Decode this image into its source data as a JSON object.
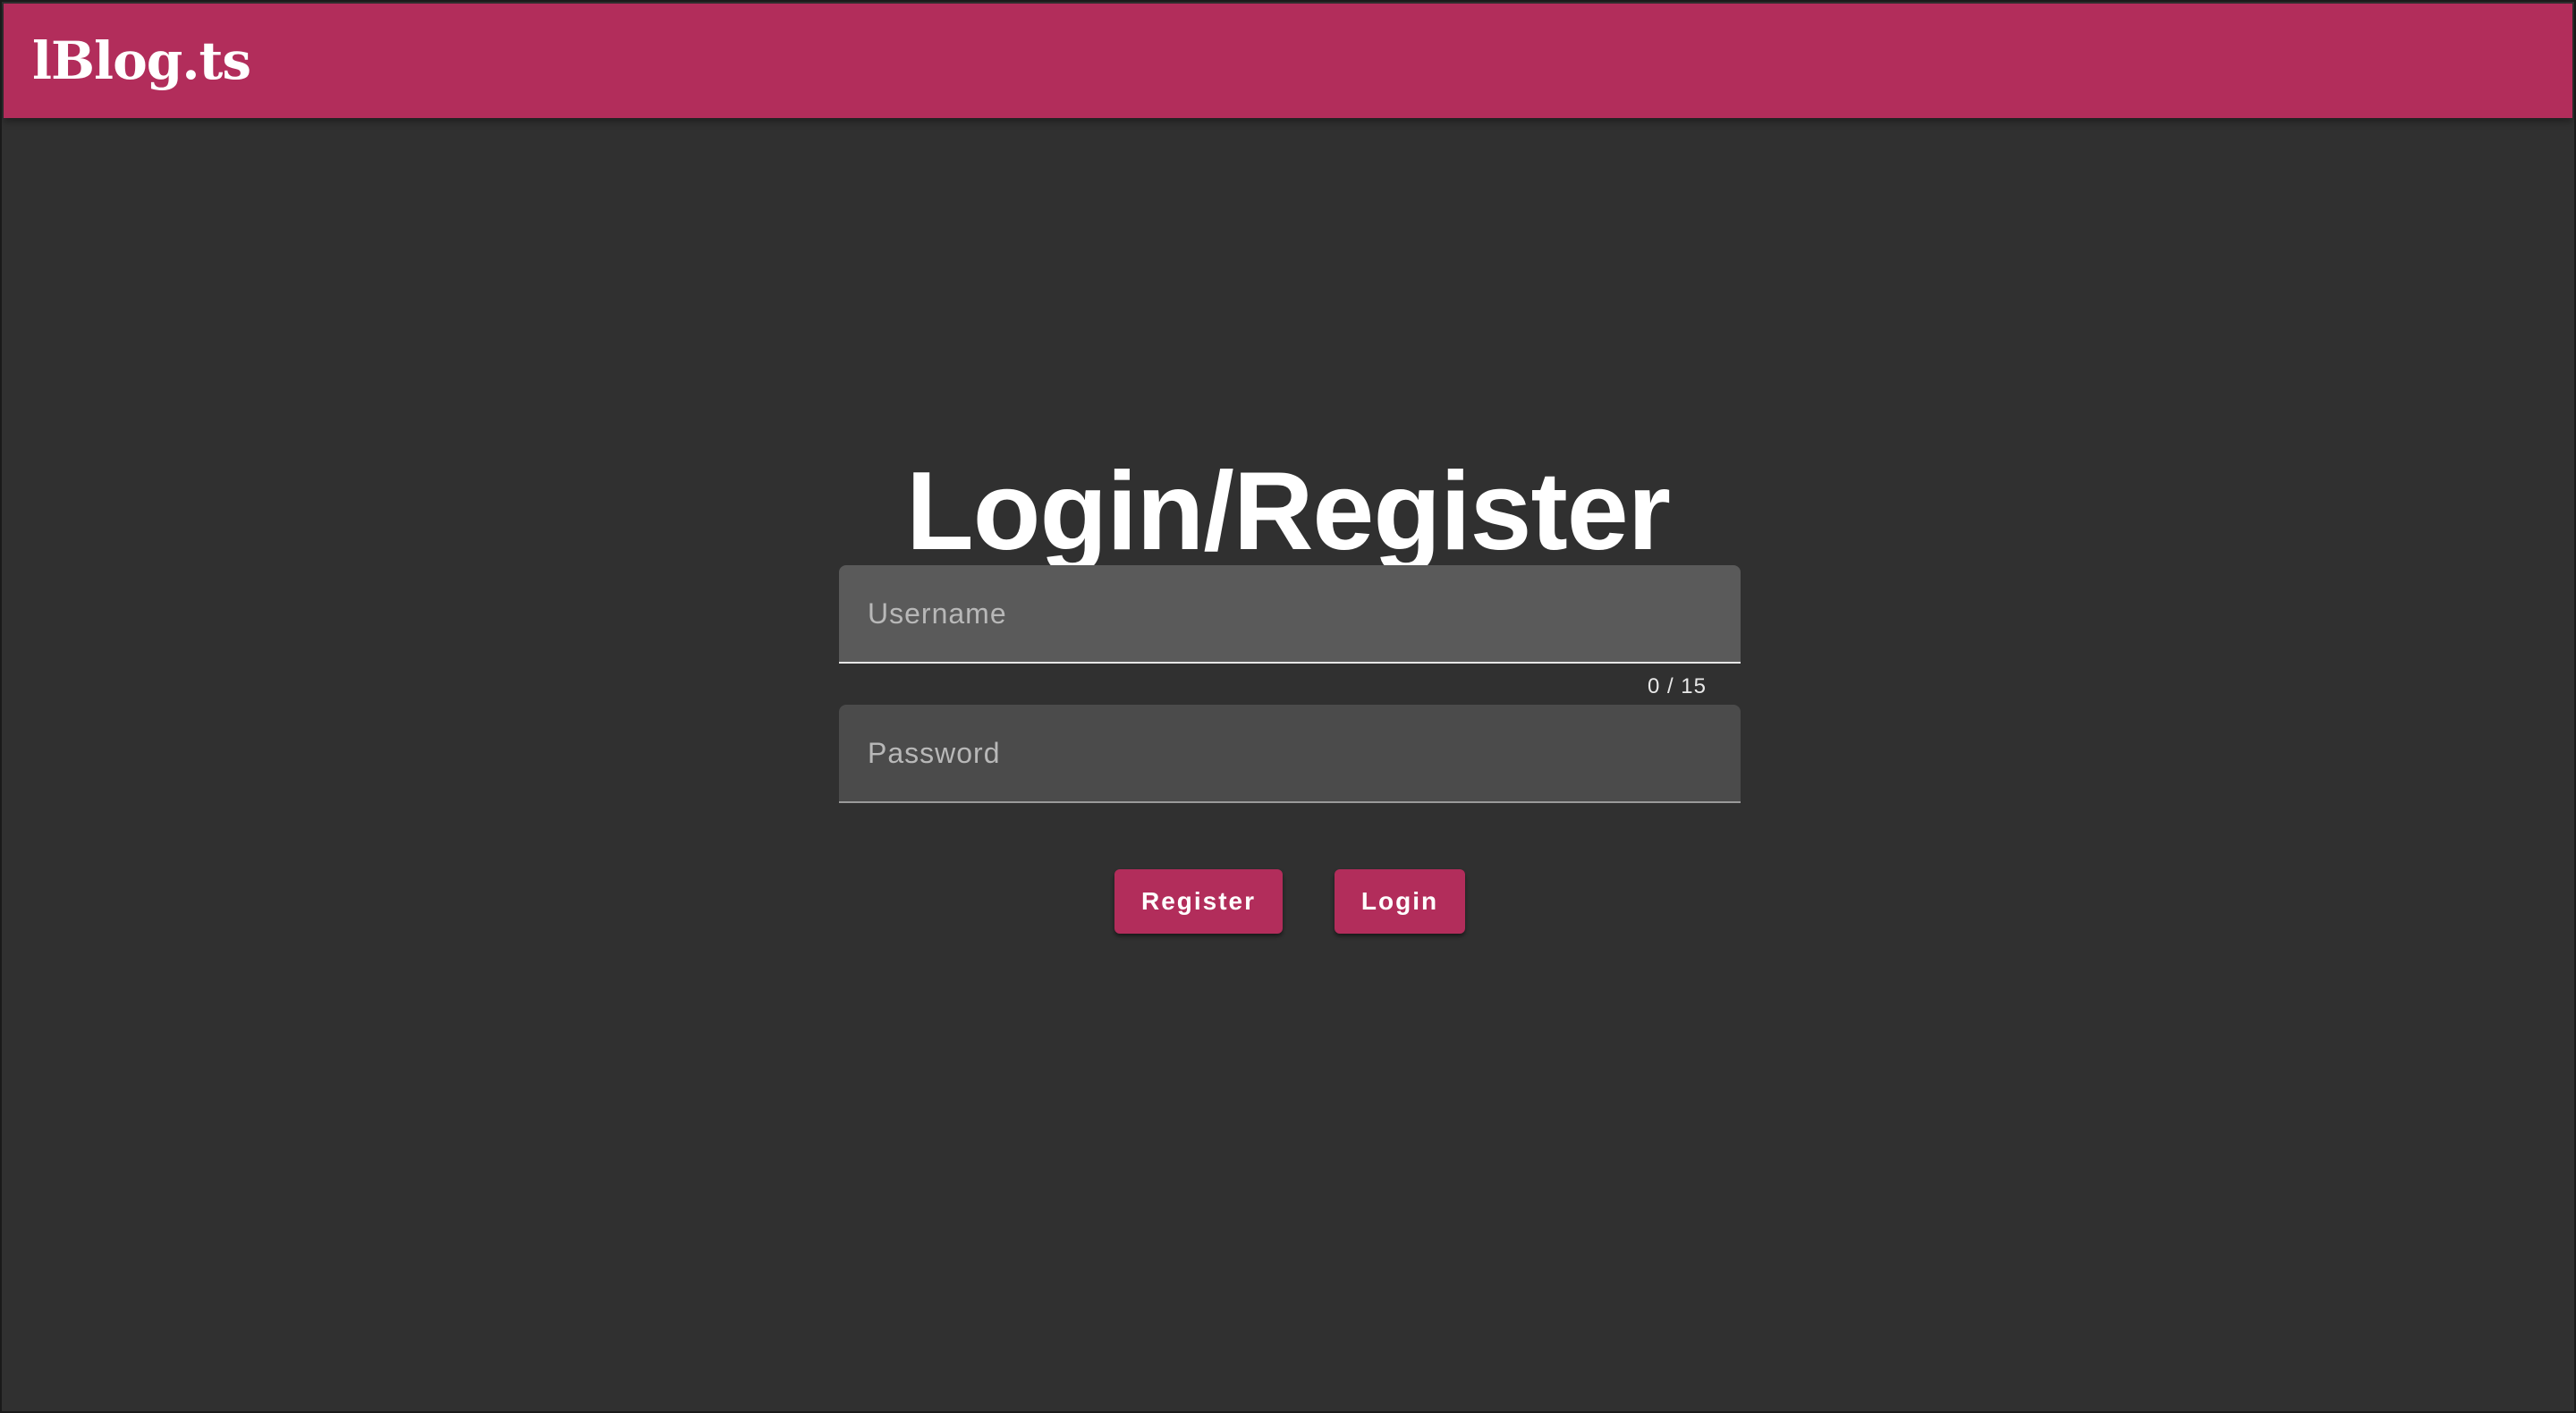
{
  "header": {
    "logo_text": "lBlog.ts",
    "bar_color": "#b22d5b"
  },
  "main": {
    "title": "Login/Register",
    "username": {
      "placeholder": "Username",
      "value": "",
      "counter": "0 / 15"
    },
    "password": {
      "placeholder": "Password",
      "value": ""
    },
    "buttons": {
      "register_label": "Register",
      "login_label": "Login"
    }
  },
  "colors": {
    "background": "#303030",
    "accent": "#b22d5b",
    "text": "#ffffff"
  }
}
